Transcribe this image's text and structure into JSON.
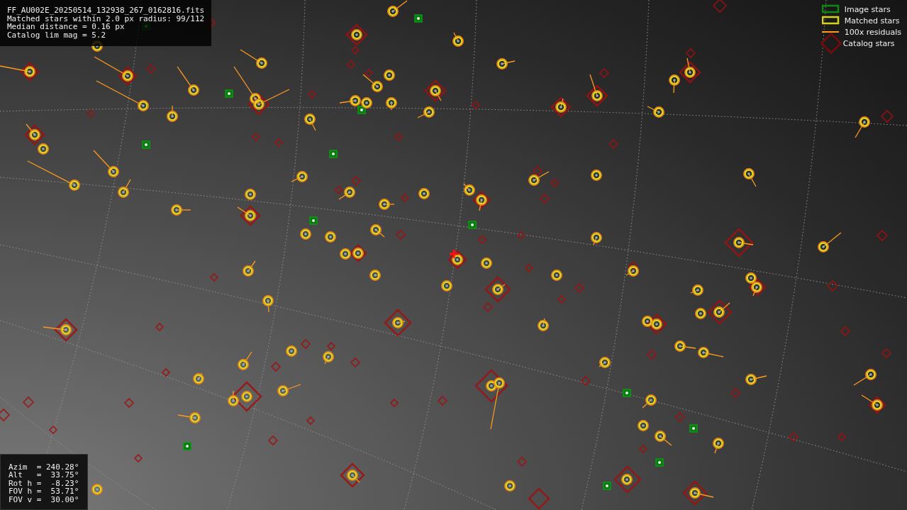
{
  "file_info": {
    "lines": [
      "FF_AU002E_20250514_132938_267_0162816.fits",
      "Matched stars within 2.0 px radius: 99/112",
      "Median distance = 0.16 px",
      "Catalog lim mag = 5.2"
    ]
  },
  "legend": [
    {
      "kind": "box",
      "color": "#0b8a12",
      "label": "Image stars"
    },
    {
      "kind": "box",
      "color": "#d4d41e",
      "label": "Matched stars"
    },
    {
      "kind": "line",
      "color": "#ff9a1e",
      "label": "100x residuals"
    },
    {
      "kind": "diamond",
      "color": "#7a0a0a",
      "label": "Catalog stars"
    }
  ],
  "pointing": {
    "lines": [
      "Azim  = 240.28°",
      "Alt   =  33.75°",
      "Rot h =  -8.23°",
      "FOV h =  53.71°",
      "FOV v =  30.00°"
    ]
  }
}
